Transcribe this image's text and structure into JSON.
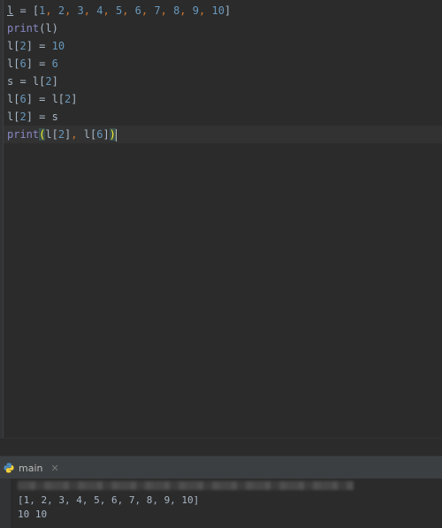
{
  "editor": {
    "lines": [
      "l = [1, 2, 3, 4, 5, 6, 7, 8, 9, 10]",
      "print(l)",
      "l[2] = 10",
      "l[6] = 6",
      "s = l[2]",
      "l[6] = l[2]",
      "l[2] = s",
      "print(l[2], l[6])"
    ],
    "current_line": 8
  },
  "run_panel": {
    "tab_label": "main",
    "tab_icon": "python-icon",
    "close_icon": "close-icon",
    "output": [
      "[1, 2, 3, 4, 5, 6, 7, 8, 9, 10]",
      "10 10"
    ]
  },
  "colors": {
    "background": "#2b2b2b",
    "text": "#a9b7c6",
    "number": "#6897bb",
    "keyword_punct": "#cc7832",
    "builtin": "#8888c6",
    "brace_highlight": "#ffef28"
  }
}
